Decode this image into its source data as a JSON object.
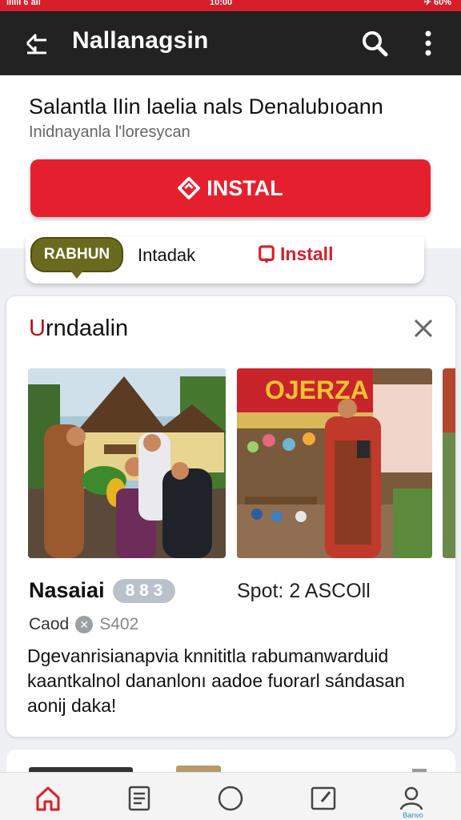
{
  "status": {
    "left": "ıııııı 6 ail",
    "center": "10:00",
    "right": "✈ 60%"
  },
  "appbar": {
    "title": "Nallanagsin",
    "back_icon": "back-icon",
    "search_icon": "search-icon",
    "more_icon": "more-vert-icon"
  },
  "hero": {
    "headline": "Salantla lIin laelia nals Denalubıoann",
    "subtitle": "Inidnayanla l'loresycan",
    "install_label": "INSTAL"
  },
  "pillbar": {
    "pill_label": "RABHUN",
    "text": "Intadak",
    "install_label": "Install"
  },
  "card": {
    "title_first": "U",
    "title_rest": "rndaalin",
    "name": "Nasaiai",
    "badge": "8 8 3",
    "spot": "Spot: 2 ASCOll",
    "meta_label": "Caod",
    "meta_number": "S402",
    "description": "Dgevanrisianapvia knnititla rabumanwarduid kaantkalnol dananlonı aadoe fuorarl sándasan aonij daka!"
  },
  "bottomnav": {
    "items": [
      {
        "icon": "home-icon",
        "active": true
      },
      {
        "icon": "list-icon"
      },
      {
        "icon": "circle-icon"
      },
      {
        "icon": "edit-icon"
      },
      {
        "icon": "profile-icon",
        "label": "Banvo"
      }
    ]
  },
  "colors": {
    "accent": "#e5202e",
    "pill": "#6a6a1e",
    "appbar": "#222222"
  }
}
